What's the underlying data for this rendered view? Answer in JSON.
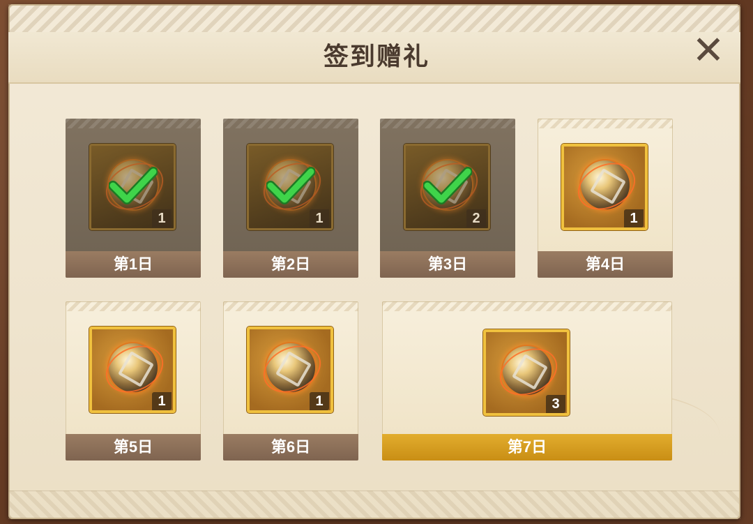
{
  "dialog": {
    "title": "签到赠礼",
    "close_label": "✕"
  },
  "days": [
    {
      "label": "第1日",
      "count": "1",
      "claimed": true
    },
    {
      "label": "第2日",
      "count": "1",
      "claimed": true
    },
    {
      "label": "第3日",
      "count": "2",
      "claimed": true
    },
    {
      "label": "第4日",
      "count": "1",
      "claimed": false
    },
    {
      "label": "第5日",
      "count": "1",
      "claimed": false
    },
    {
      "label": "第6日",
      "count": "1",
      "claimed": false
    },
    {
      "label": "第7日",
      "count": "3",
      "claimed": false
    }
  ],
  "colors": {
    "claimed_bg": "#7a6c5a",
    "gold_frame": "#f0c13e",
    "check": "#3fd44a",
    "title_text": "#4a3a2e"
  },
  "icons": {
    "reward": "glowing-orb-icon",
    "claimed_mark": "check-icon"
  }
}
